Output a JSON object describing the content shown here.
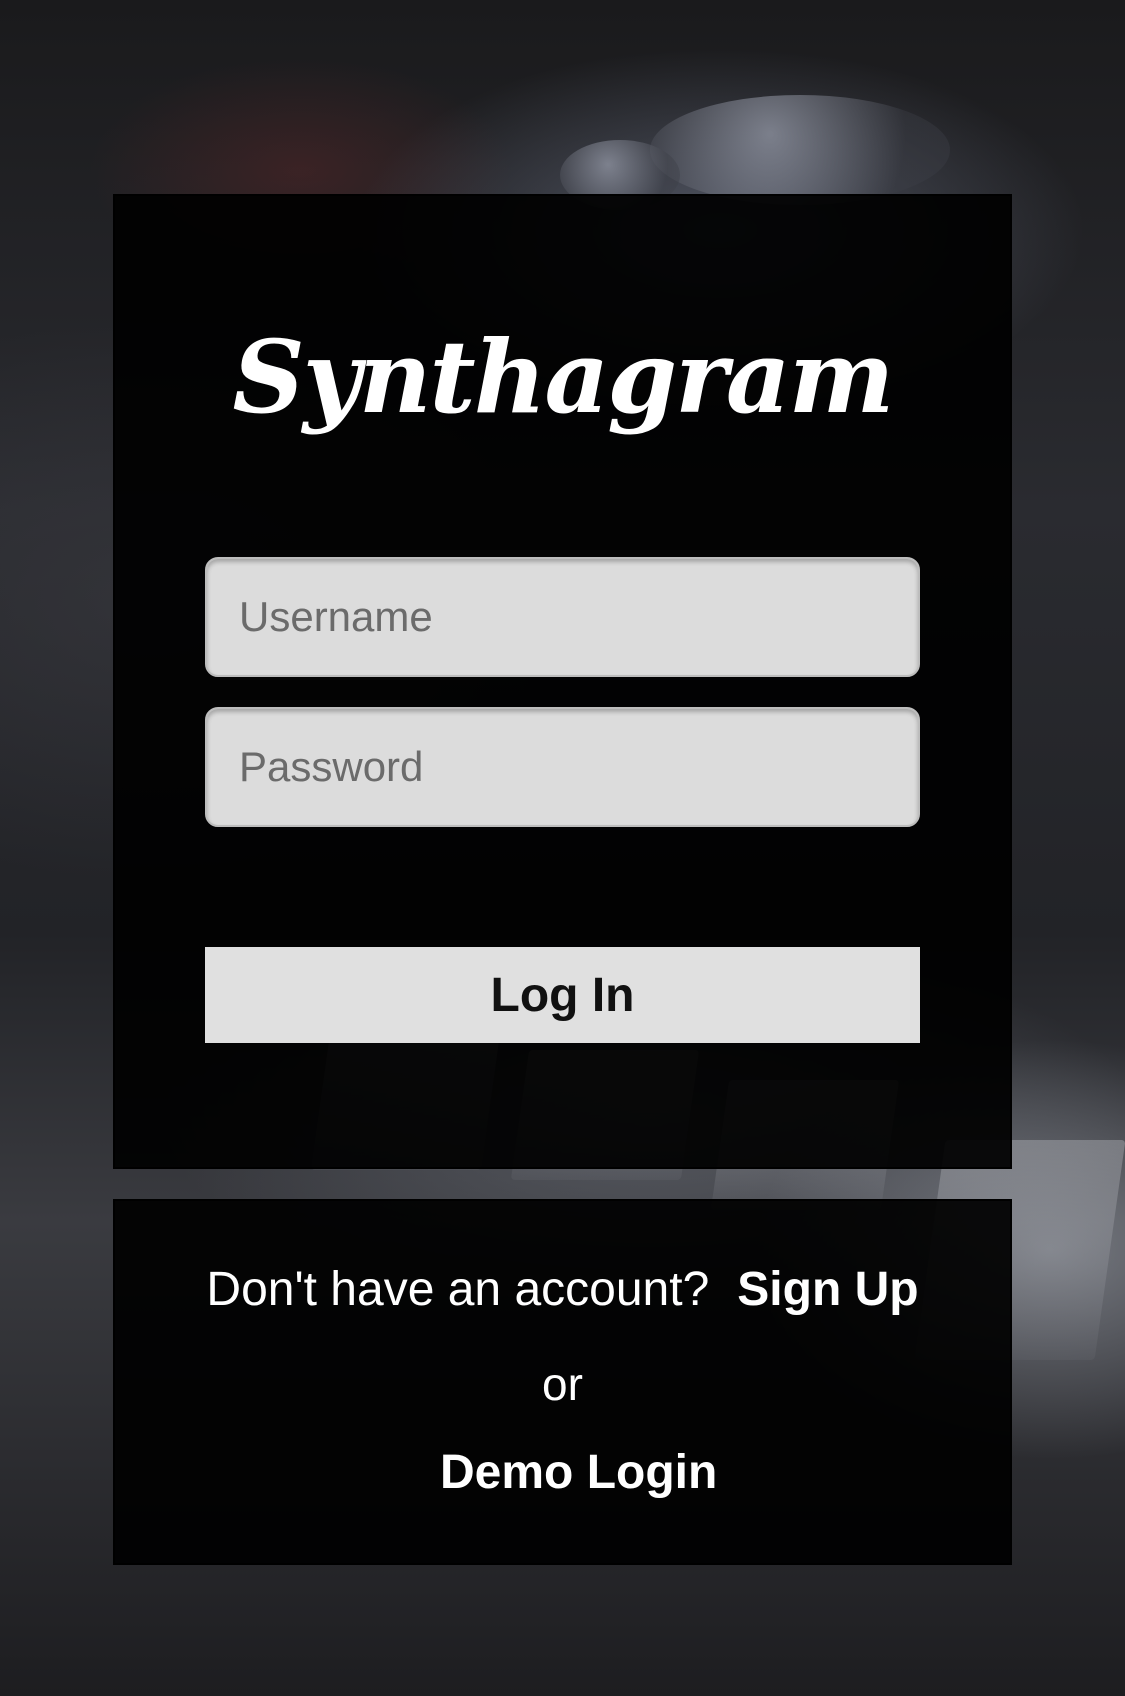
{
  "app": {
    "logo_text": "Synthagram"
  },
  "login_form": {
    "username_placeholder": "Username",
    "password_placeholder": "Password",
    "login_button_label": "Log In"
  },
  "signup": {
    "prompt_text": "Don't have an account?",
    "signup_link_label": "Sign Up",
    "or_text": "or",
    "demo_login_label": "Demo Login"
  }
}
